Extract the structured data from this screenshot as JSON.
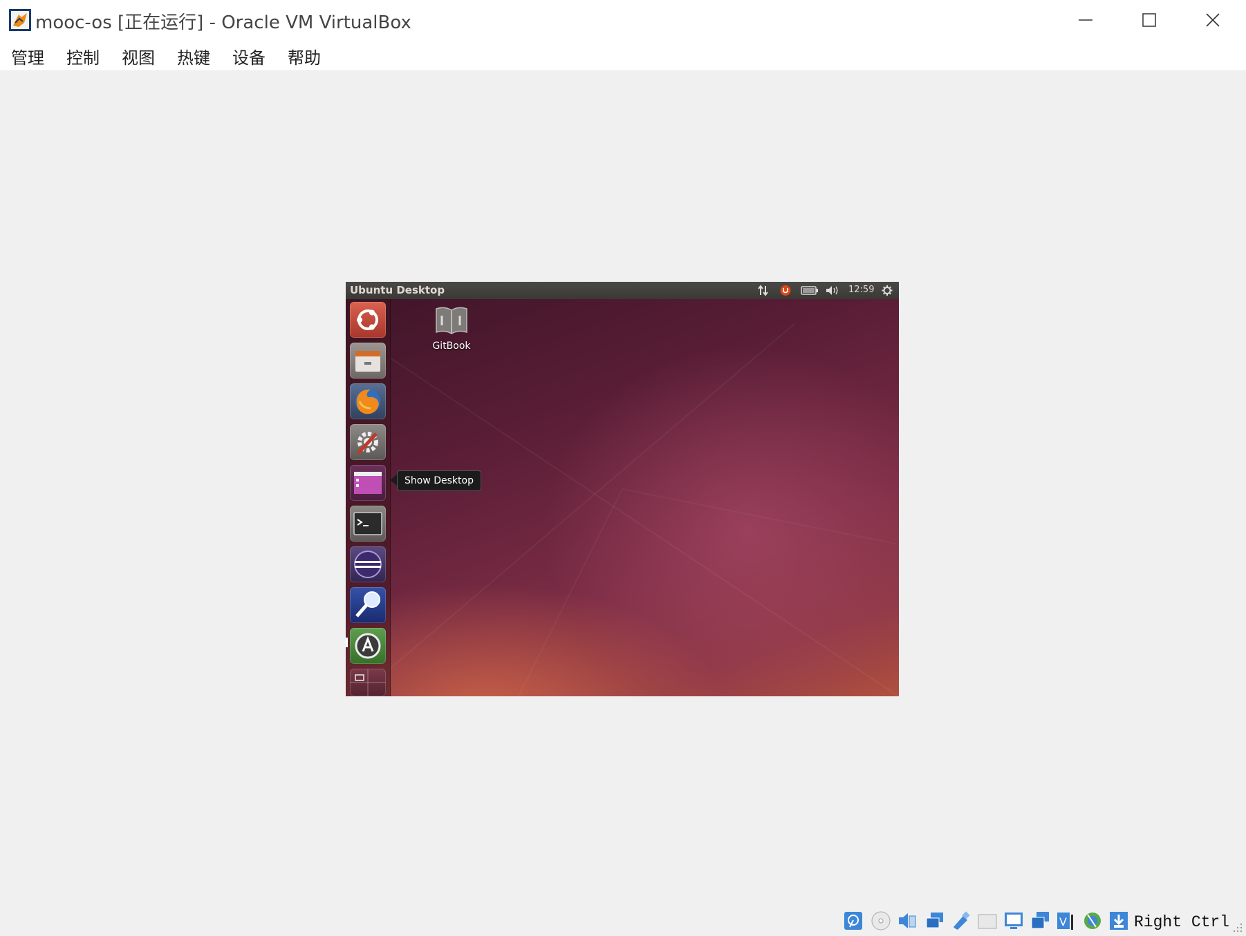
{
  "window": {
    "title": "mooc-os [正在运行] - Oracle VM VirtualBox",
    "controls": [
      "minimize",
      "maximize",
      "close"
    ]
  },
  "menubar": {
    "items": [
      "管理",
      "控制",
      "视图",
      "热键",
      "设备",
      "帮助"
    ]
  },
  "guest": {
    "panel_title": "Ubuntu Desktop",
    "clock": "12:59",
    "tray_icons": [
      "network-updown-icon",
      "ubuntuone-icon",
      "battery-icon",
      "volume-icon",
      "gear-icon"
    ],
    "launcher_items": [
      {
        "name": "dash-home-icon",
        "color": "#c34a3c"
      },
      {
        "name": "file-manager-icon",
        "color": "#8a8480"
      },
      {
        "name": "firefox-icon",
        "color": "#3b6fb5"
      },
      {
        "name": "system-settings-icon",
        "color": "#7e7a78"
      },
      {
        "name": "show-desktop-icon",
        "color": "#a03f9a"
      },
      {
        "name": "terminal-icon",
        "color": "#2b2b2b"
      },
      {
        "name": "eclipse-icon",
        "color": "#3c2a6d"
      },
      {
        "name": "gtk-search-icon",
        "color": "#2240a0"
      },
      {
        "name": "software-updater-icon",
        "color": "#4b8a3f"
      },
      {
        "name": "workspace-switcher-icon",
        "color": "#6a3040"
      }
    ],
    "desktop_icon": {
      "label": "GitBook",
      "icon": "book-icon"
    },
    "tooltip": "Show Desktop",
    "accent": "#dd4814"
  },
  "statusbar": {
    "icons": [
      "hard-disk-icon",
      "optical-drive-icon",
      "audio-icon",
      "network-icon",
      "usb-icon",
      "shared-folder-icon",
      "display-icon",
      "video-capture-icon",
      "virtualization-icon",
      "mouse-integration-icon",
      "host-key-icon"
    ],
    "host_key": "Right Ctrl"
  }
}
